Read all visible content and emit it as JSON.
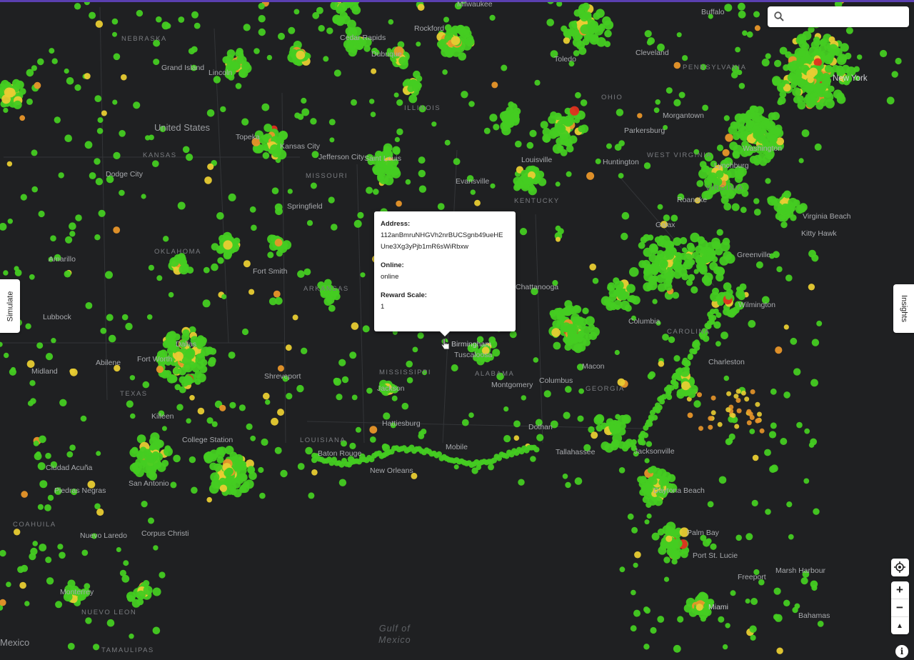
{
  "map": {
    "countries": [
      "United States",
      "Mexico"
    ],
    "states": [
      "NEBRASKA",
      "KANSAS",
      "MISSOURI",
      "ILLINOIS",
      "OHIO",
      "PENNSYLVANIA",
      "WEST VIRGINIA",
      "VIRGINIA",
      "KENTUCKY",
      "OKLAHOMA",
      "ARKANSAS",
      "TEXAS",
      "MISSISSIPPI",
      "ALABAMA",
      "GEORGIA",
      "LOUISIANA",
      "CAROLINA",
      "COAHUILA",
      "NUEVO LEON",
      "TAMAULIPAS"
    ],
    "cities": [
      "New York",
      "Lincoln",
      "Grand Island",
      "Topeka",
      "Kansas City",
      "Jefferson City",
      "Springfield",
      "Saint Louis",
      "Evansville",
      "Louisville",
      "Huntington",
      "Parkersburg",
      "Morgantown",
      "Roanoke",
      "Virginia Beach",
      "Kitty Hawk",
      "Greenville",
      "Wilmington",
      "Charleston",
      "Columbia",
      "Macon",
      "Columbus",
      "Montgomery",
      "Birmingham",
      "Tuscaloosa",
      "Chattanooga",
      "Jackson",
      "Hattiesburg",
      "Mobile",
      "Baton Rouge",
      "New Orleans",
      "Tallahassee",
      "Jacksonville",
      "Daytona Beach",
      "Palm Bay",
      "Port St. Lucie",
      "Freeport",
      "Marsh Harbour",
      "Miami",
      "Bahamas",
      "Amarillo",
      "Lubbock",
      "Abilene",
      "Midland",
      "Fort Worth",
      "Dallas",
      "Killeen",
      "College Station",
      "San Antonio",
      "Ciudad Acuña",
      "Piedras Negras",
      "Nuevo Laredo",
      "Corpus Christi",
      "Monterrey",
      "Dodge City",
      "Toledo",
      "Cleveland",
      "Rockford",
      "Buffalo",
      "Dothan",
      "Shreveport",
      "Fort Smith",
      "Galax",
      "Lynchburg",
      "Washington",
      "Cedar Rapids",
      "Dubuque",
      "Milwaukee"
    ],
    "water": [
      "Gulf of",
      "Mexico"
    ]
  },
  "search": {
    "placeholder": ""
  },
  "side_tabs": {
    "left": "Simulate",
    "right": "Insights"
  },
  "popup": {
    "address_label": "Address:",
    "address_line1": "112anBmruNHGVh2nrBUCSgnb49ueHE",
    "address_line2": "Une3Xg3yPjb1mR6sWiRbxw",
    "online_label": "Online:",
    "online_value": "online",
    "reward_label": "Reward Scale:",
    "reward_value": "1"
  },
  "controls": {
    "zoom_in": "+",
    "zoom_out": "−",
    "north": "▲",
    "info": "i"
  },
  "colors": {
    "green": "#44cc22",
    "yellow": "#e8cc33",
    "orange": "#e8962a",
    "red": "#e03020",
    "accent": "#5a3fb0"
  }
}
